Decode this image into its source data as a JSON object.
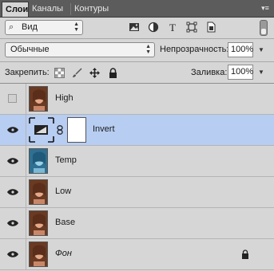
{
  "tabs": [
    {
      "label": "Слои",
      "active": true
    },
    {
      "label": "Каналы",
      "active": false
    },
    {
      "label": "Контуры",
      "active": false
    }
  ],
  "panel_menu_icon": "panel-menu-icon",
  "filter": {
    "kind_label": "Вид",
    "icons": [
      "image-filter-icon",
      "adjustment-filter-icon",
      "type-filter-icon",
      "shape-filter-icon",
      "smart-object-filter-icon"
    ]
  },
  "blend": {
    "mode": "Обычные",
    "opacity_label": "Непрозрачность:",
    "opacity_value": "100%"
  },
  "lock": {
    "label": "Закрепить:",
    "icons": [
      "lock-transparent-icon",
      "lock-image-icon",
      "lock-position-icon",
      "lock-all-icon"
    ],
    "fill_label": "Заливка:",
    "fill_value": "100%"
  },
  "layers": [
    {
      "name": "High",
      "visible": false,
      "thumb": "portrait-warm",
      "italic": false,
      "selected": false
    },
    {
      "name": "Invert",
      "visible": true,
      "thumb": "adjustment-invert",
      "italic": false,
      "selected": true
    },
    {
      "name": "Temp",
      "visible": true,
      "thumb": "portrait-cool",
      "italic": false,
      "selected": false
    },
    {
      "name": "Low",
      "visible": true,
      "thumb": "portrait-warm",
      "italic": false,
      "selected": false
    },
    {
      "name": "Base",
      "visible": true,
      "thumb": "portrait-warm",
      "italic": false,
      "selected": false
    },
    {
      "name": "Фон",
      "visible": true,
      "thumb": "portrait-warm",
      "italic": true,
      "selected": false,
      "locked": true
    }
  ],
  "colors": {
    "tabbar": "#5c5c5c",
    "panel": "#d6d6d6",
    "selected_row": "#b7cdf2"
  }
}
